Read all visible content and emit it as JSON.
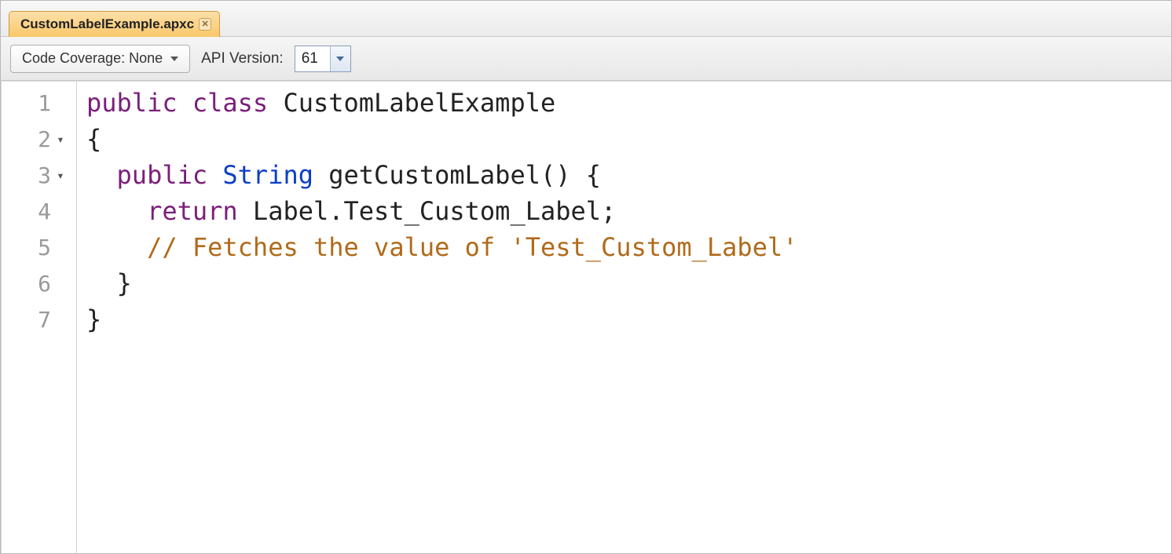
{
  "tab": {
    "filename": "CustomLabelExample.apxc"
  },
  "toolbar": {
    "coverage_label": "Code Coverage: None",
    "api_version_label": "API Version:",
    "api_version_value": "61"
  },
  "gutter": {
    "lines": [
      "1",
      "2",
      "3",
      "4",
      "5",
      "6",
      "7"
    ],
    "folds": {
      "2": "▾",
      "3": "▾"
    }
  },
  "code": {
    "l1": {
      "kw1": "public",
      "kw2": "class",
      "ident": "CustomLabelExample"
    },
    "l2": {
      "brace": "{"
    },
    "l3": {
      "indent": "  ",
      "kw1": "public",
      "type": "String",
      "ident": "getCustomLabel",
      "parens": "()",
      "brace": " {"
    },
    "l4": {
      "indent": "    ",
      "kw": "return",
      "expr": " Label.Test_Custom_Label;"
    },
    "l5": {
      "indent": "    ",
      "comment": "// Fetches the value of 'Test_Custom_Label'"
    },
    "l6": {
      "indent": "  ",
      "brace": "}"
    },
    "l7": {
      "brace": "}"
    }
  }
}
